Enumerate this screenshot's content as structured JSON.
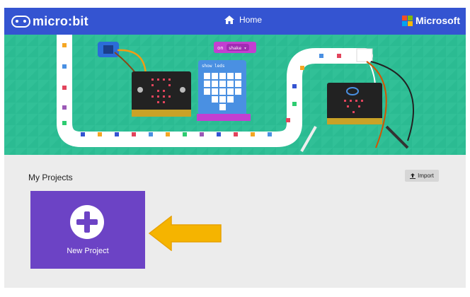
{
  "header": {
    "brand": "micro:bit",
    "home_label": "Home",
    "company": "Microsoft",
    "color": "#3454d1"
  },
  "hero": {
    "block_event": "on",
    "block_param": "shake ▾",
    "block_show": "show leds"
  },
  "main": {
    "section_title": "My Projects",
    "import_label": "Import",
    "new_project_label": "New Project",
    "card_color": "#6c43c5"
  }
}
